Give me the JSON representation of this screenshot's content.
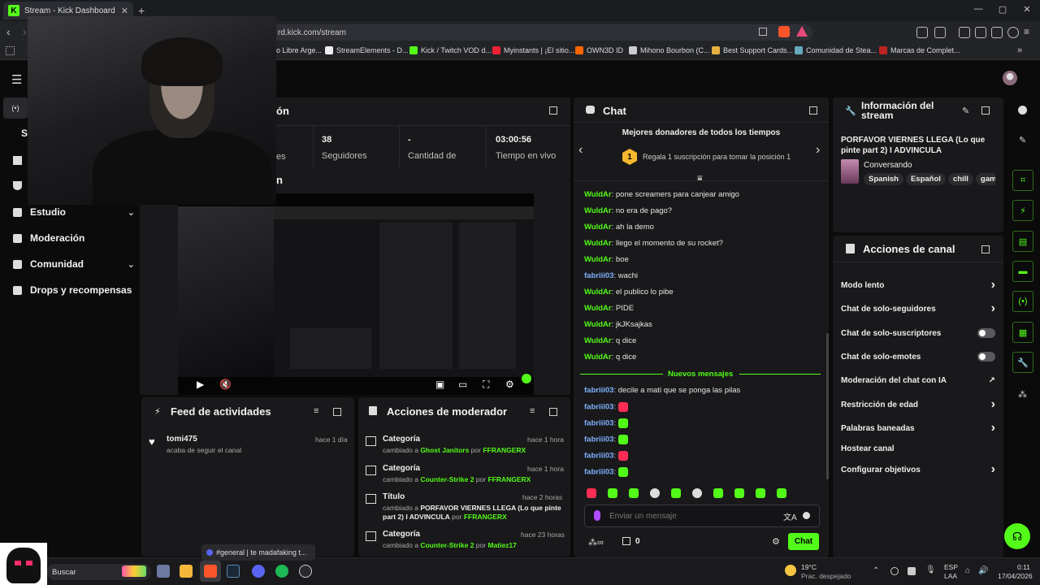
{
  "browser": {
    "tab_title": "Stream - Kick Dashboard",
    "url": "rd.kick.com/stream",
    "bookmarks": [
      "o Libre Arge...",
      "StreamElements - D...",
      "Kick / Twitch VOD d...",
      "Myinstants | ¡El sitio...",
      "OWN3D ID",
      "Mihono Bourbon (C...",
      "Best Support Cards...",
      "Comunidad de Stea...",
      "Marcas de Complet..."
    ]
  },
  "sidebar": {
    "items": [
      {
        "label": "S"
      },
      {
        "label": "Estudio"
      },
      {
        "label": "Moderación"
      },
      {
        "label": "Comunidad"
      },
      {
        "label": "Drops y recompensas"
      }
    ]
  },
  "stats_panel": {
    "title_fragment": "ón",
    "stats": [
      {
        "value": "",
        "label": "es"
      },
      {
        "value": "38",
        "label": "Seguidores"
      },
      {
        "value": "-",
        "label": "Cantidad de"
      },
      {
        "value": "03:00:56",
        "label": "Tiempo en vivo"
      }
    ]
  },
  "video_panel": {
    "title_fragment": "n"
  },
  "feed": {
    "title": "Feed de actividades",
    "items": [
      {
        "user": "tomi475",
        "desc": "acaba de seguir el canal",
        "time": "hace 1 día"
      }
    ]
  },
  "mod_actions": {
    "title": "Acciones de moderador",
    "items": [
      {
        "title": "Categoría",
        "time": "hace 1 hora",
        "prefix": "cambiado a ",
        "value": "Ghost Janitors",
        "by": " por ",
        "mod": "FFRANGERX"
      },
      {
        "title": "Categoría",
        "time": "hace 1 hora",
        "prefix": "cambiado a ",
        "value": "Counter-Strike 2",
        "by": " por ",
        "mod": "FFRANGERX"
      },
      {
        "title": "Título",
        "time": "hace 2 horas",
        "prefix": "cambiado a ",
        "value": "PORFAVOR VIERNES LLEGA (Lo que pinte part 2) I ADVINCULA",
        "by": " por ",
        "mod": "FFRANGERX"
      },
      {
        "title": "Categoría",
        "time": "hace 23 horas",
        "prefix": "cambiado a ",
        "value": "Counter-Strike 2",
        "by": " por ",
        "mod": "Matiez17"
      }
    ]
  },
  "chat": {
    "title": "Chat",
    "donors_title": "Mejores donadores de todos los tiempos",
    "donor_rank": "1",
    "donor_text": "Regala 1 suscripción para tomar la posición 1",
    "messages": [
      {
        "user": "WuldAr",
        "text": "pone screamers para canjear amigo",
        "color": "#53fc18"
      },
      {
        "user": "WuldAr",
        "text": "no era de pago?",
        "color": "#53fc18"
      },
      {
        "user": "WuldAr",
        "text": "ah la demo",
        "color": "#53fc18"
      },
      {
        "user": "WuldAr",
        "text": "llego el momento de su rocket?",
        "color": "#53fc18"
      },
      {
        "user": "WuldAr",
        "text": "boe",
        "color": "#53fc18"
      },
      {
        "user": "fabriii03",
        "text": "wachi",
        "color": "#7fb2ff"
      },
      {
        "user": "WuldAr",
        "text": "el publico lo pibe",
        "color": "#53fc18"
      },
      {
        "user": "WuldAr",
        "text": "PIDE",
        "color": "#53fc18"
      },
      {
        "user": "WuldAr",
        "text": "jkJKsajkas",
        "color": "#53fc18"
      },
      {
        "user": "WuldAr",
        "text": "q dice",
        "color": "#53fc18"
      },
      {
        "user": "WuldAr",
        "text": "q dice",
        "color": "#53fc18"
      }
    ],
    "new_messages_label": "Nuevos mensajes",
    "new_messages": [
      {
        "user": "fabriii03",
        "text": "decile a mati que se ponga las pilas",
        "color": "#7fb2ff"
      },
      {
        "user": "fabriii03",
        "text": "",
        "color": "#7fb2ff",
        "emote": "#ff2d55"
      },
      {
        "user": "fabriii03",
        "text": "",
        "color": "#7fb2ff",
        "emote": "#53fc18"
      },
      {
        "user": "fabriii03",
        "text": "",
        "color": "#7fb2ff",
        "emote": "#53fc18"
      },
      {
        "user": "fabriii03",
        "text": "",
        "color": "#7fb2ff",
        "emote": "#ff2d55"
      },
      {
        "user": "fabriii03",
        "text": "",
        "color": "#7fb2ff",
        "emote": "#53fc18"
      }
    ],
    "input_placeholder": "Enviar un mensaje",
    "points_label": "0",
    "send_label": "Chat"
  },
  "stream_info": {
    "title": "Información del stream",
    "stream_title": "PORFAVOR VIERNES LLEGA (Lo que pinte part 2) I ADVINCULA",
    "category": "Conversando",
    "tags": [
      "Spanish",
      "Español",
      "chill",
      "gam"
    ]
  },
  "channel_actions": {
    "title": "Acciones de canal",
    "items": [
      {
        "label": "Modo lento",
        "control": "chevron"
      },
      {
        "label": "Chat de solo-seguidores",
        "control": "chevron"
      },
      {
        "label": "Chat de solo-suscriptores",
        "control": "toggle"
      },
      {
        "label": "Chat de solo-emotes",
        "control": "toggle"
      },
      {
        "label": "Moderación del chat con IA",
        "control": "external"
      },
      {
        "label": "Restricción de edad",
        "control": "chevron"
      },
      {
        "label": "Palabras baneadas",
        "control": "chevron"
      },
      {
        "label": "Hostear canal",
        "control": "none"
      },
      {
        "label": "Configurar objetivos",
        "control": "chevron"
      }
    ]
  },
  "taskbar": {
    "search": "Buscar",
    "tooltip": "#general | te madafaking t...",
    "weather_temp": "19°C",
    "weather_desc": "Prac. despejado",
    "lang": "ESP",
    "lang2": "LAA",
    "time": "0:11",
    "date": "17/04/2026"
  },
  "colors": {
    "kick_green": "#53fc18",
    "panel": "#19191b",
    "background": "#0b0b0c"
  }
}
